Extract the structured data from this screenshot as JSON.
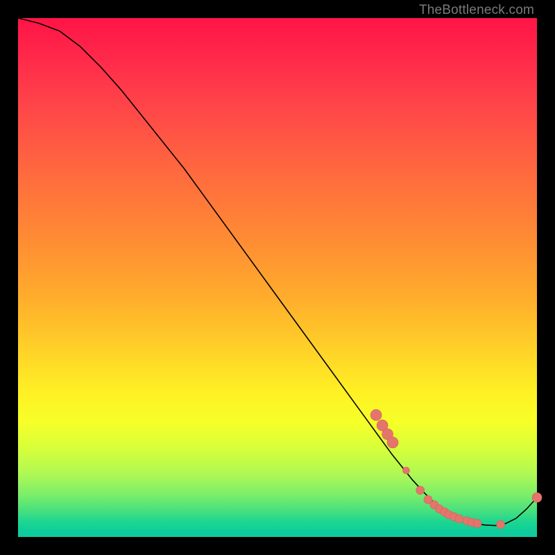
{
  "watermark": "TheBottleneck.com",
  "colors": {
    "marker_fill": "#e4756d",
    "marker_stroke": "#d85f57",
    "curve": "#000000"
  },
  "chart_data": {
    "type": "line",
    "title": "",
    "xlabel": "",
    "ylabel": "",
    "xlim": [
      0,
      100
    ],
    "ylim": [
      0,
      100
    ],
    "note": "No axis ticks or labels are rendered; values are read as percentages of the plot width/height. Y is 0 at the bottom, 100 at the top.",
    "series": [
      {
        "name": "curve",
        "x": [
          0,
          4,
          8,
          12,
          16,
          20,
          24,
          28,
          32,
          36,
          40,
          44,
          48,
          52,
          56,
          60,
          64,
          68,
          72,
          74,
          76,
          78,
          80,
          82,
          84,
          86,
          88,
          90,
          92,
          94,
          96,
          98,
          100
        ],
        "y": [
          100,
          99,
          97.5,
          94.5,
          90.5,
          86,
          81,
          76,
          71,
          65.5,
          60,
          54.5,
          49,
          43.5,
          38,
          32.5,
          27,
          21.5,
          16,
          13.5,
          11,
          8.8,
          6.8,
          5.2,
          4.0,
          3.2,
          2.6,
          2.3,
          2.2,
          2.6,
          3.6,
          5.4,
          7.6
        ]
      }
    ],
    "markers": {
      "name": "highlighted-points",
      "x": [
        69.0,
        70.2,
        71.2,
        72.2,
        74.8,
        77.5,
        79.0,
        80.2,
        81.2,
        82.2,
        83.0,
        84.0,
        85.0,
        86.5,
        87.5,
        88.5,
        93.0,
        100.0
      ],
      "y": [
        23.5,
        21.5,
        19.8,
        18.2,
        12.8,
        9.0,
        7.2,
        6.2,
        5.4,
        4.8,
        4.3,
        3.9,
        3.5,
        3.1,
        2.8,
        2.6,
        2.4,
        7.6
      ],
      "r": [
        8,
        8,
        8,
        8,
        5,
        6,
        6,
        6,
        6,
        6,
        6,
        6,
        6,
        6,
        6,
        6,
        6,
        7
      ]
    }
  }
}
